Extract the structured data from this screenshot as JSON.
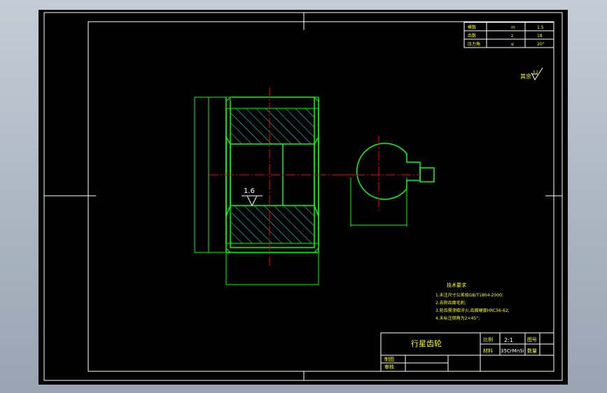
{
  "drawing": {
    "part_name": "行星齿轮",
    "scale_label": "比例",
    "scale_value": "2:1",
    "drawing_no_label": "图号",
    "material_label": "材料",
    "material_value": "35CrMnSi",
    "quantity_label": "数量",
    "drawn_by_label": "制图",
    "checked_by_label": "审核"
  },
  "gear_params": {
    "rows": [
      {
        "name": "模数",
        "symbol": "m",
        "value": "1.5"
      },
      {
        "name": "齿数",
        "symbol": "z",
        "value": "18"
      },
      {
        "name": "压力角",
        "symbol": "α",
        "value": "20°"
      }
    ]
  },
  "surface_finish": {
    "other_label": "其余",
    "default_value": "3.2",
    "bore_value": "1.6"
  },
  "tech_requirements": {
    "title": "技术要求",
    "items": [
      "1.未注尺寸公差按GB/T1804-2000;",
      "2.去除齿面毛刺;",
      "3.轮齿需渗碳淬火,齿面硬度HRC56-62;",
      "4.未标注倒角为2×45°;"
    ]
  },
  "colors": {
    "outline": "#00ff00",
    "center_line": "#ff0000",
    "hatch": "#00ffff",
    "frame": "#ffffff",
    "text": "#ffff00"
  }
}
